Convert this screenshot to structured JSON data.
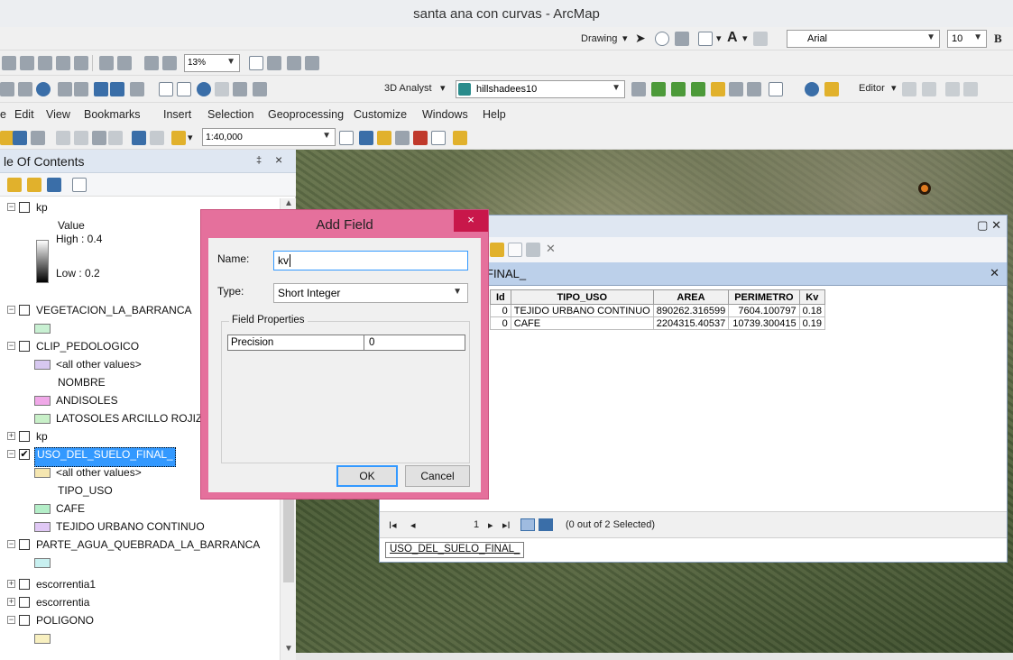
{
  "window": {
    "title": "santa ana con curvas - ArcMap"
  },
  "toolbar_draw": {
    "drawing_label": "Drawing",
    "font_name": "Arial",
    "font_size": "10",
    "bold_label": "B"
  },
  "toolbar_layout": {
    "zoom_percent": "13%"
  },
  "toolbar_3d": {
    "analyst_label": "3D Analyst",
    "layer_selected": "hillshadees10",
    "editor_label": "Editor"
  },
  "menu": {
    "items": [
      "e",
      "Edit",
      "View",
      "Bookmarks",
      "Insert",
      "Selection",
      "Geoprocessing",
      "Customize",
      "Windows",
      "Help"
    ]
  },
  "toolbar_standard": {
    "scale": "1:40,000"
  },
  "toc": {
    "title": "le Of Contents",
    "pin": "‡",
    "close": "×",
    "layers": [
      {
        "label": "kp",
        "expanded": true,
        "checked": false
      },
      {
        "label": "Value"
      },
      {
        "label": "High : 0.4"
      },
      {
        "label": "Low : 0.2"
      },
      {
        "label": "VEGETACION_LA_BARRANCA",
        "expanded": true,
        "checked": false
      },
      {
        "label": "CLIP_PEDOLOGICO",
        "expanded": true,
        "checked": false
      },
      {
        "label": "<all other values>"
      },
      {
        "label": "NOMBRE"
      },
      {
        "label": "ANDISOLES"
      },
      {
        "label": "LATOSOLES ARCILLO ROJIZOS"
      },
      {
        "label": "kp",
        "expanded": false,
        "checked": false
      },
      {
        "label": "USO_DEL_SUELO_FINAL_",
        "expanded": true,
        "checked": true
      },
      {
        "label": "<all other values>"
      },
      {
        "label": "TIPO_USO"
      },
      {
        "label": "CAFE"
      },
      {
        "label": "TEJIDO URBANO CONTINUO"
      },
      {
        "label": "PARTE_AGUA_QUEBRADA_LA_BARRANCA",
        "expanded": true,
        "checked": false
      },
      {
        "label": "escorrentia1",
        "expanded": false,
        "checked": false
      },
      {
        "label": "escorrentia",
        "expanded": false,
        "checked": false
      },
      {
        "label": "POLIGONO",
        "expanded": true,
        "checked": false
      }
    ],
    "colors": {
      "vegetacion": "#c8f0d2",
      "all_other_1": "#d7c8f0",
      "andisoles": "#f0a8e8",
      "latosoles": "#c8f0c8",
      "all_other_2": "#f5e6b0",
      "cafe": "#b4eec8",
      "tejido": "#e0c8f5",
      "parte_agua": "#c8f0f0",
      "poligono": "#f8f0c0"
    }
  },
  "attr_table": {
    "tab_title": "FINAL_",
    "columns": [
      "Id",
      "TIPO_USO",
      "AREA",
      "PERIMETRO",
      "Kv"
    ],
    "rows": [
      [
        "0",
        "TEJIDO URBANO CONTINUO",
        "890262.316599",
        "7604.100797",
        "0.18"
      ],
      [
        "0",
        "CAFE",
        "2204315.40537",
        "10739.300415",
        "0.19"
      ]
    ],
    "nav": {
      "first": "◀◀",
      "prev": "◀",
      "record": "1",
      "next": "▶",
      "last": "▶▶",
      "selected_text": "(0 out of 2 Selected)"
    },
    "sheet_tab": "USO_DEL_SUELO_FINAL_"
  },
  "add_field": {
    "title": "Add Field",
    "name_label": "Name:",
    "name_value": "kv",
    "type_label": "Type:",
    "type_value": "Short Integer",
    "props_legend": "Field Properties",
    "prop_key": "Precision",
    "prop_value": "0",
    "ok_label": "OK",
    "cancel_label": "Cancel",
    "close_glyph": "×"
  }
}
